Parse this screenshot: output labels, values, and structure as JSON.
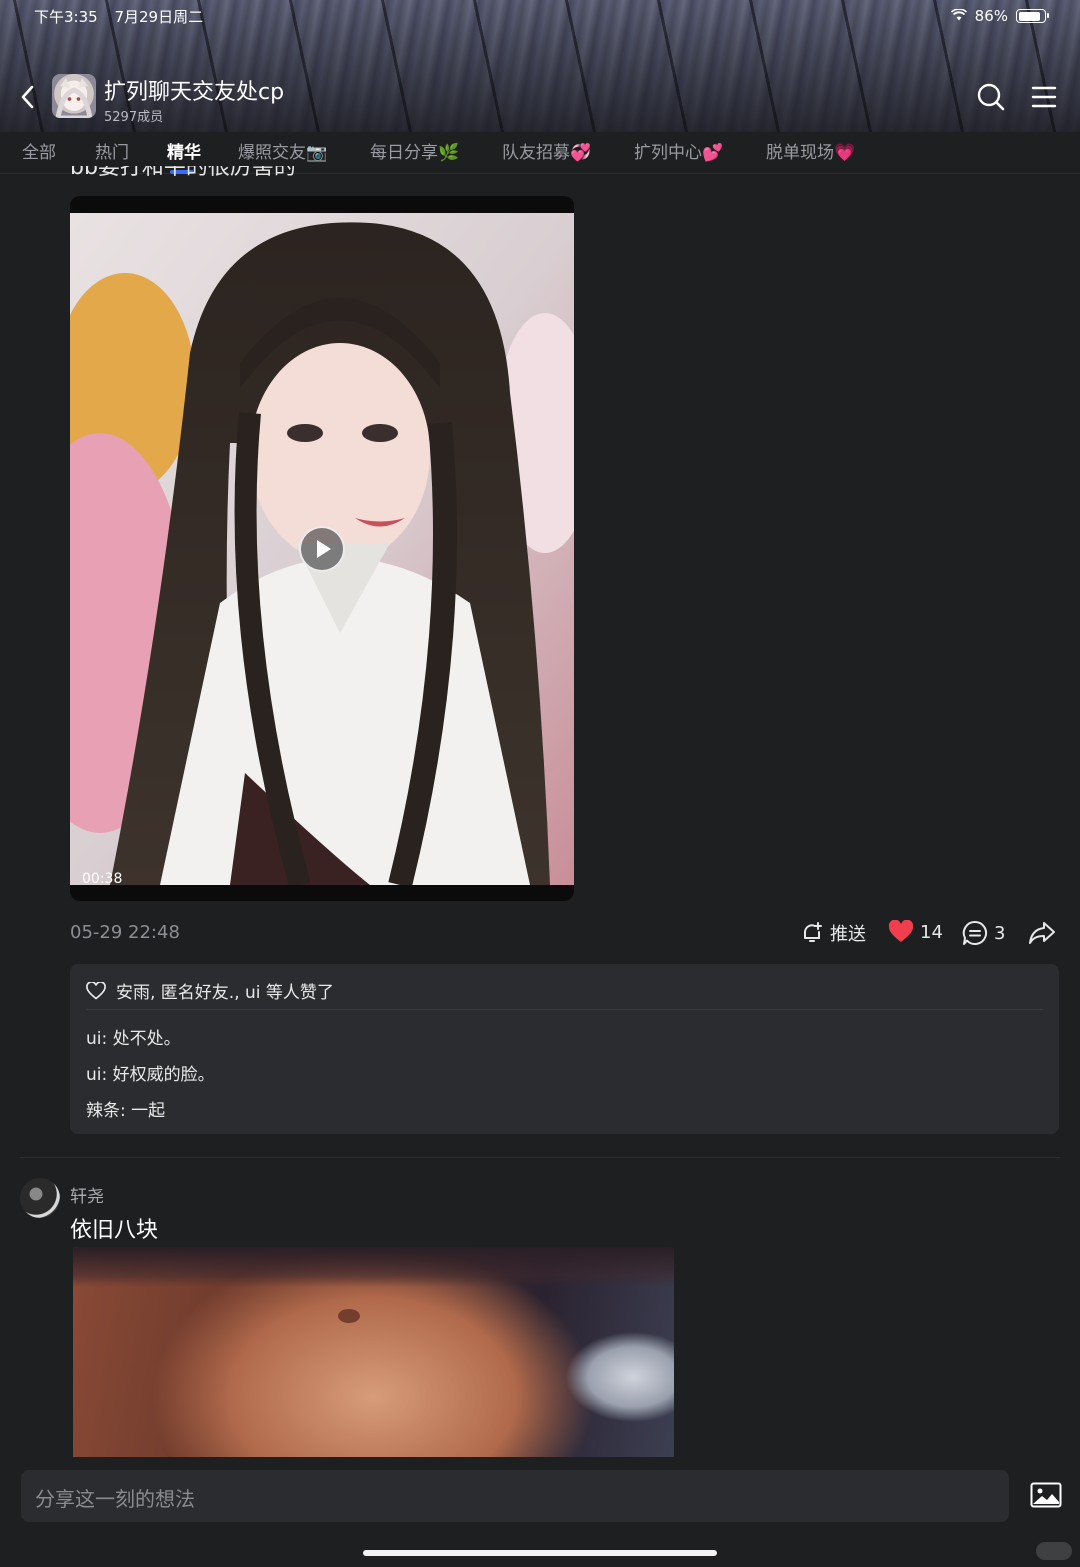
{
  "status_bar": {
    "time": "下午3:35",
    "date": "7月29日周二",
    "battery": "86%",
    "battery_level": 0.86
  },
  "header": {
    "title": "扩列聊天交友处cp",
    "members": "5297成员"
  },
  "tabs": [
    {
      "label": "全部"
    },
    {
      "label": "热门"
    },
    {
      "label": "精华"
    },
    {
      "label": "爆照交友📷"
    },
    {
      "label": "每日分享🌿"
    },
    {
      "label": "队友招募💞"
    },
    {
      "label": "扩列中心💕"
    },
    {
      "label": "脱单现场💗"
    }
  ],
  "active_tab": "精华",
  "post1": {
    "title": "bb要打和平的很厉害的",
    "video_duration": "00:38",
    "time": "05-29 22:48",
    "push_label": "推送",
    "likes": "14",
    "comments_count": "3",
    "liked_by": "安雨, 匿名好友., ui 等人赞了",
    "comments": [
      {
        "author": "ui",
        "text": "处不处。"
      },
      {
        "author": "ui",
        "text": "好权威的脸。"
      },
      {
        "author": "辣条",
        "text": "一起"
      }
    ]
  },
  "post2": {
    "author": "轩尧",
    "text": "依旧八块"
  },
  "composer": {
    "placeholder": "分享这一刻的想法"
  },
  "colors": {
    "accent": "#3a6cf5",
    "like": "#f03e4e",
    "background": "#1e1f21",
    "card": "#2b2c2f"
  }
}
